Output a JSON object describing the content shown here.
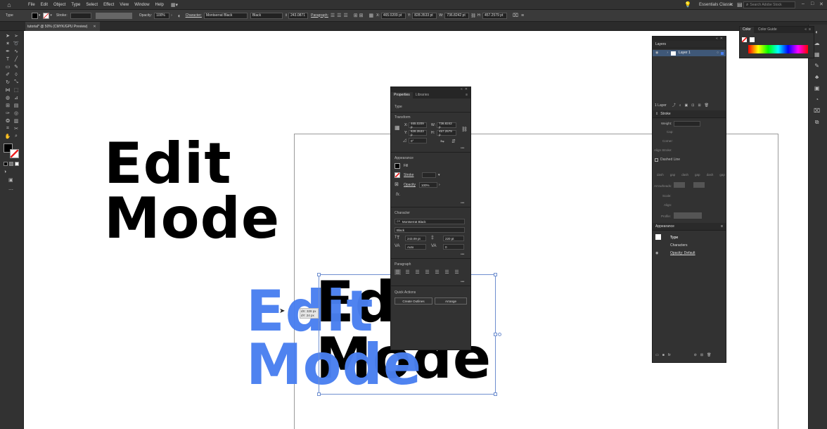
{
  "menu": {
    "items": [
      "File",
      "Edit",
      "Object",
      "Type",
      "Select",
      "Effect",
      "View",
      "Window",
      "Help"
    ],
    "workspace": "Essentials Classic",
    "search_placeholder": "Search Adobe Stock"
  },
  "control_bar": {
    "type_label": "Type",
    "stroke_label": "Stroke:",
    "opacity_label": "Opacity:",
    "opacity_value": "100%",
    "character_label": "Character:",
    "font_name": "Montserrat Black",
    "font_style": "Black",
    "font_size": "243.0871",
    "paragraph_label": "Paragraph:",
    "x_value": "465.0209 pt",
    "y_value": "828.3533 pt",
    "w_value": "736.8242 pt",
    "h_value": "457.2579 pt"
  },
  "document_tab": "tutorial* @ 50% (CMYK/GPU Preview)",
  "canvas": {
    "text_top_line1": "Edit",
    "text_top_line2": "Mode",
    "text_dup_line1": "Edit",
    "text_dup_line2": "Mode",
    "drag_tooltip_dx": "dX: 328 px",
    "drag_tooltip_dy": "dY: 24 px"
  },
  "properties_panel": {
    "tab_properties": "Properties",
    "tab_libraries": "Libraries",
    "type_label": "Type",
    "transform_label": "Transform",
    "x": "465.0209 p",
    "y": "828.3533 p",
    "w": "736.8242 p",
    "h": "457.2579 p",
    "angle": "0°",
    "appearance_label": "Appearance",
    "fill_label": "Fill",
    "stroke_label": "Stroke",
    "opacity_label": "Opacity",
    "opacity_value": "100%",
    "character_label": "Character",
    "font_name": "Montserrat Black",
    "font_style": "Black",
    "font_size": "243.09 pt",
    "leading": "220 pt",
    "kerning": "Auto",
    "tracking": "0",
    "paragraph_label": "Paragraph",
    "quick_actions_label": "Quick Actions",
    "create_outlines": "Create Outlines",
    "arrange": "Arrange"
  },
  "layers_panel": {
    "title": "Layers",
    "layer_name": "Layer 1",
    "layer_count": "1 Layer"
  },
  "stroke_panel": {
    "title": "Stroke",
    "weight_label": "Weight:",
    "cap_label": "Cap:",
    "corner_label": "Corner:",
    "align_label": "Align Stroke:",
    "dashed_label": "Dashed Line",
    "dash_labels": [
      "dash",
      "gap",
      "dash",
      "gap",
      "dash",
      "gap"
    ],
    "arrowheads_label": "Arrowheads:",
    "scale_label": "Scale:",
    "align_arrow_label": "Align:",
    "profile_label": "Profile:"
  },
  "appearance_panel": {
    "title": "Appearance",
    "type_label": "Type",
    "characters_label": "Characters",
    "opacity_label": "Opacity: Default"
  },
  "color_panel": {
    "tab_color": "Color",
    "tab_guide": "Color Guide"
  },
  "colors": {
    "accent_blue": "#4a7ff0",
    "panel_bg": "#323232",
    "canvas_bg": "#ffffff"
  }
}
